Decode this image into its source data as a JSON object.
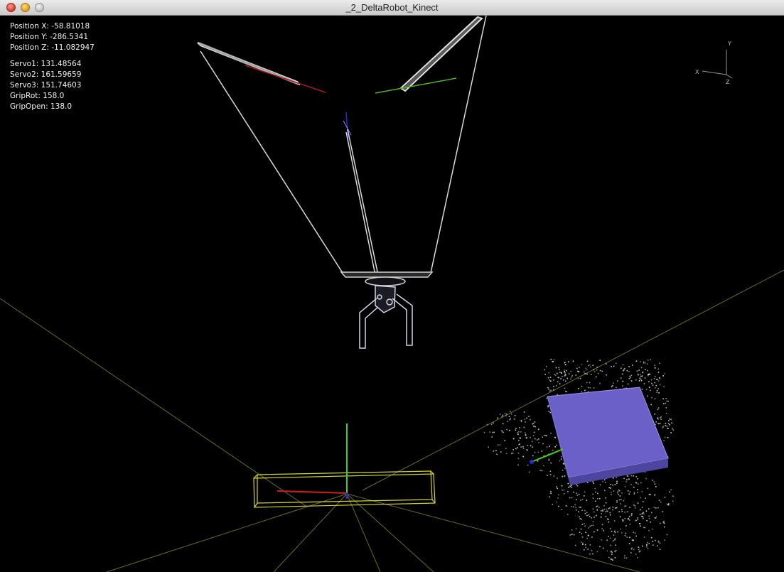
{
  "window": {
    "title": "_2_DeltaRobot_Kinect"
  },
  "hud": {
    "position_x": "Position X: -58.81018",
    "position_y": "Position Y: -286.5341",
    "position_z": "Position Z: -11.082947",
    "servo1": "Servo1: 131.48564",
    "servo2": "Servo2: 161.59659",
    "servo3": "Servo3: 151.74603",
    "grip_rot": "GripRot: 158.0",
    "grip_open": "GripOpen: 138.0"
  },
  "axis_gizmo": {
    "x_label": "X",
    "y_label": "Y",
    "z_label": "Z"
  },
  "colors": {
    "background": "#000000",
    "frame_lines": "#e6e6e6",
    "floor_grid": "#6b6b1a",
    "target_box": "#6a60c8",
    "axis_x": "#d21e1e",
    "axis_y": "#3ed21e",
    "axis_z": "#2a2ad8",
    "bounding_box": "#d8d820",
    "point_cloud": "#d8d8d8"
  }
}
